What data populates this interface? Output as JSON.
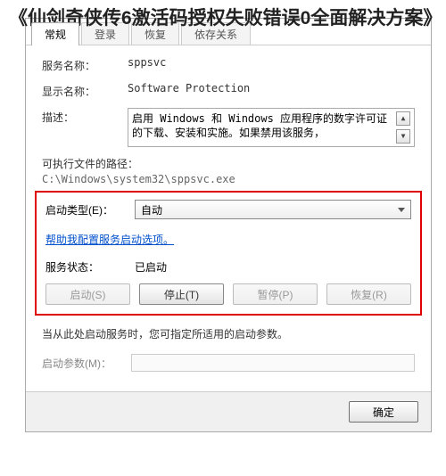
{
  "article": {
    "title": "《仙剑奇侠传6激活码授权失败错误0全面解决方案》"
  },
  "dialog": {
    "tabs": {
      "general": "常规",
      "logon": "登录",
      "recovery": "恢复",
      "dependencies": "依存关系"
    },
    "fields": {
      "serviceNameLabel": "服务名称：",
      "serviceName": "sppsvc",
      "displayNameLabel": "显示名称：",
      "displayName": "Software Protection",
      "descriptionLabel": "描述：",
      "description": "启用 Windows 和 Windows 应用程序的数字许可证的下载、安装和实施。如果禁用该服务，",
      "exePathLabel": "可执行文件的路径：",
      "exePath": "C:\\Windows\\system32\\sppsvc.exe",
      "startupTypeLabel": "启动类型(E)：",
      "startupType": "自动",
      "helpLink": "帮助我配置服务启动选项。",
      "statusLabel": "服务状态：",
      "status": "已启动",
      "hintText": "当从此处启动服务时，您可指定所适用的启动参数。",
      "paramLabel": "启动参数(M)："
    },
    "buttons": {
      "start": "启动(S)",
      "stop": "停止(T)",
      "pause": "暂停(P)",
      "resume": "恢复(R)",
      "ok": "确定"
    }
  }
}
